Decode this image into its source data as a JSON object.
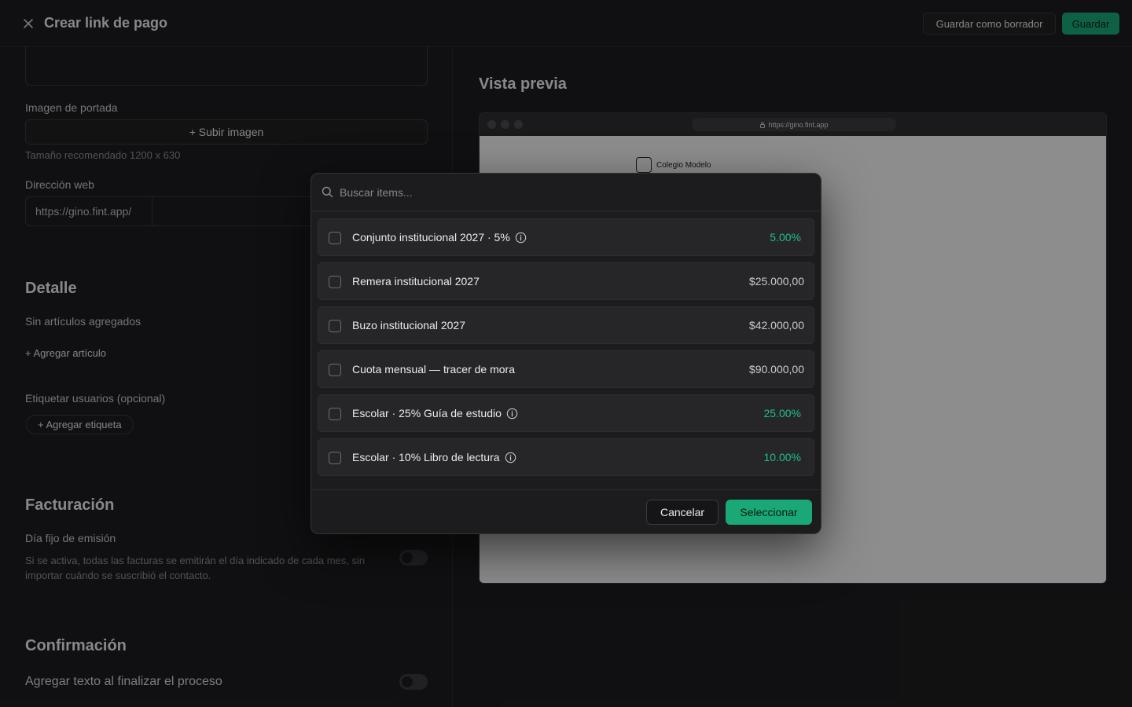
{
  "header": {
    "title": "Crear link de pago",
    "draft_label": "Guardar como borrador",
    "save_label": "Guardar"
  },
  "form": {
    "cover_image_label": "Imagen de portada",
    "upload_label": "+ Subir imagen",
    "upload_hint": "Tamaño recomendado 1200 x 630",
    "web_address_label": "Dirección web",
    "url_prefix": "https://gino.fint.app/",
    "detail_title": "Detalle",
    "no_items": "Sin artículos agregados",
    "add_item": "+ Agregar artículo",
    "tag_users_label": "Etiquetar usuarios (opcional)",
    "add_tag": "+ Agregar etiqueta",
    "billing_title": "Facturación",
    "fixed_day_label": "Día fijo de emisión",
    "fixed_day_desc": "Si se activa, todas las facturas se emitirán el día indicado de cada mes, sin importar cuándo se suscribió el contacto.",
    "confirmation_title": "Confirmación",
    "end_text_label": "Agregar texto al finalizar el proceso"
  },
  "preview": {
    "title": "Vista previa",
    "url": "https://gino.fint.app",
    "school_name": "Colegio Modelo"
  },
  "modal": {
    "search_placeholder": "Buscar items...",
    "items": [
      {
        "label": "Conjunto institucional 2027 · 5%",
        "value": "5.00%",
        "info": true
      },
      {
        "label": "Remera institucional 2027",
        "value": "$25.000,00",
        "info": false
      },
      {
        "label": "Buzo institucional 2027",
        "value": "$42.000,00",
        "info": false
      },
      {
        "label": "Cuota mensual — tracer de mora",
        "value": "$90.000,00",
        "info": false
      },
      {
        "label": "Escolar · 25% Guía de estudio",
        "value": "25.00%",
        "info": true
      },
      {
        "label": "Escolar · 10% Libro de lectura",
        "value": "10.00%",
        "info": true
      }
    ],
    "cancel_label": "Cancelar",
    "select_label": "Seleccionar"
  },
  "colors": {
    "accent": "#1aa877",
    "percent_text": "#1fbf86",
    "background": "#1d1d1f"
  }
}
